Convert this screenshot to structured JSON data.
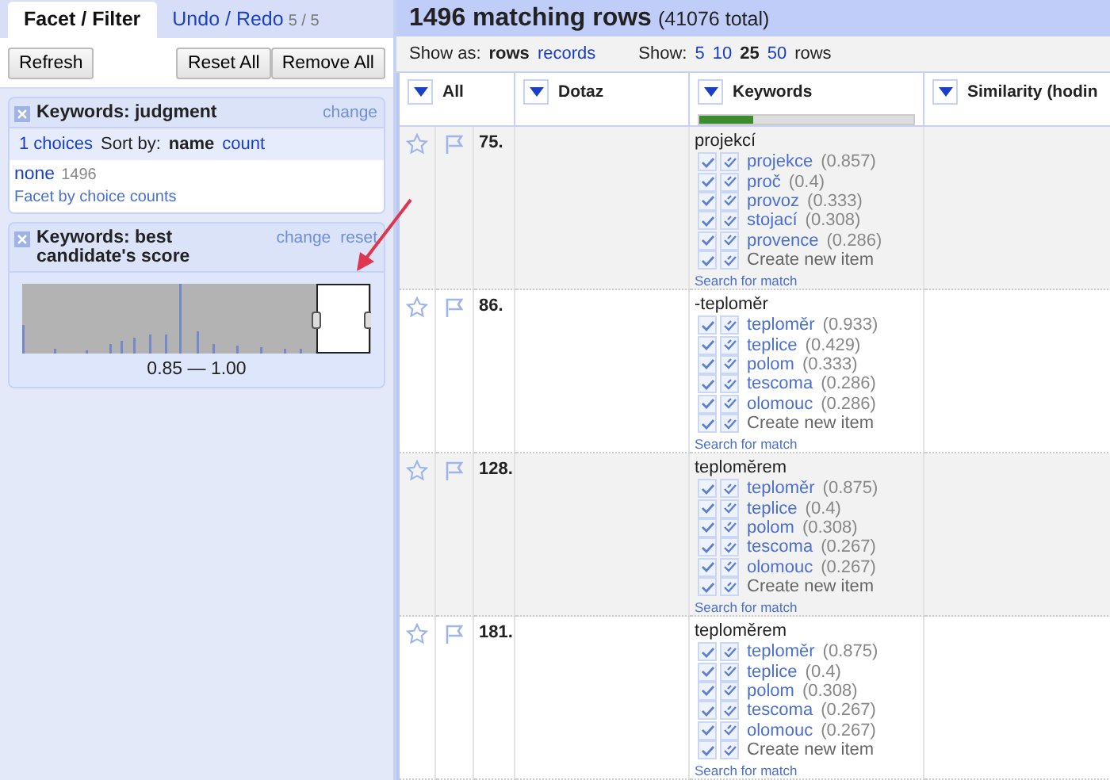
{
  "tabs": [
    {
      "label": "Facet / Filter",
      "selected": true
    },
    {
      "label": "Undo / Redo",
      "count": "5 / 5",
      "selected": false
    }
  ],
  "buttons": {
    "refresh": "Refresh",
    "reset_all": "Reset All",
    "remove_all": "Remove All"
  },
  "facets": [
    {
      "kind": "list",
      "title": "Keywords: judgment",
      "actions": [
        "change"
      ],
      "choices_count": "1 choices",
      "sort_label": "Sort by:",
      "sort_options": [
        {
          "label": "name",
          "selected": true
        },
        {
          "label": "count",
          "selected": false
        }
      ],
      "choices": [
        {
          "label": "none",
          "count": "1496"
        }
      ],
      "footer_link": "Facet by choice counts"
    },
    {
      "kind": "range",
      "title": "Keywords: best candidate's score",
      "actions": [
        "change",
        "reset"
      ],
      "range_label": "0.85 — 1.00"
    }
  ],
  "header": {
    "count": "1496 matching rows",
    "total": "(41076 total)"
  },
  "view": {
    "show_as_label": "Show as:",
    "modes": [
      {
        "label": "rows",
        "selected": true
      },
      {
        "label": "records",
        "selected": false
      }
    ],
    "show_label": "Show:",
    "page_sizes": [
      {
        "label": "5",
        "selected": false
      },
      {
        "label": "10",
        "selected": false
      },
      {
        "label": "25",
        "selected": true
      },
      {
        "label": "50",
        "selected": false
      }
    ],
    "rows_suffix": "rows"
  },
  "columns": [
    {
      "label": "All"
    },
    {
      "label": "Dotaz"
    },
    {
      "label": "Keywords",
      "level": 0.25
    },
    {
      "label": "Similarity (hodin"
    }
  ],
  "rows": [
    {
      "number": "75.",
      "keyword": "projekcí",
      "candidates": [
        {
          "name": "projekce",
          "score": "(0.857)"
        },
        {
          "name": "proč",
          "score": "(0.4)"
        },
        {
          "name": "provoz",
          "score": "(0.333)"
        },
        {
          "name": "stojací",
          "score": "(0.308)"
        },
        {
          "name": "provence",
          "score": "(0.286)"
        }
      ],
      "create_label": "Create new item",
      "search_link": "Search for match"
    },
    {
      "number": "86.",
      "keyword": "-teploměr",
      "candidates": [
        {
          "name": "teploměr",
          "score": "(0.933)"
        },
        {
          "name": "teplice",
          "score": "(0.429)"
        },
        {
          "name": "polom",
          "score": "(0.333)"
        },
        {
          "name": "tescoma",
          "score": "(0.286)"
        },
        {
          "name": "olomouc",
          "score": "(0.286)"
        }
      ],
      "create_label": "Create new item",
      "search_link": "Search for match"
    },
    {
      "number": "128.",
      "keyword": "teploměrem",
      "candidates": [
        {
          "name": "teploměr",
          "score": "(0.875)"
        },
        {
          "name": "teplice",
          "score": "(0.4)"
        },
        {
          "name": "polom",
          "score": "(0.308)"
        },
        {
          "name": "tescoma",
          "score": "(0.267)"
        },
        {
          "name": "olomouc",
          "score": "(0.267)"
        }
      ],
      "create_label": "Create new item",
      "search_link": "Search for match"
    },
    {
      "number": "181.",
      "keyword": "teploměrem",
      "candidates": [
        {
          "name": "teploměr",
          "score": "(0.875)"
        },
        {
          "name": "teplice",
          "score": "(0.4)"
        },
        {
          "name": "polom",
          "score": "(0.308)"
        },
        {
          "name": "tescoma",
          "score": "(0.267)"
        },
        {
          "name": "olomouc",
          "score": "(0.267)"
        }
      ],
      "create_label": "Create new item",
      "search_link": "Search for match"
    }
  ]
}
